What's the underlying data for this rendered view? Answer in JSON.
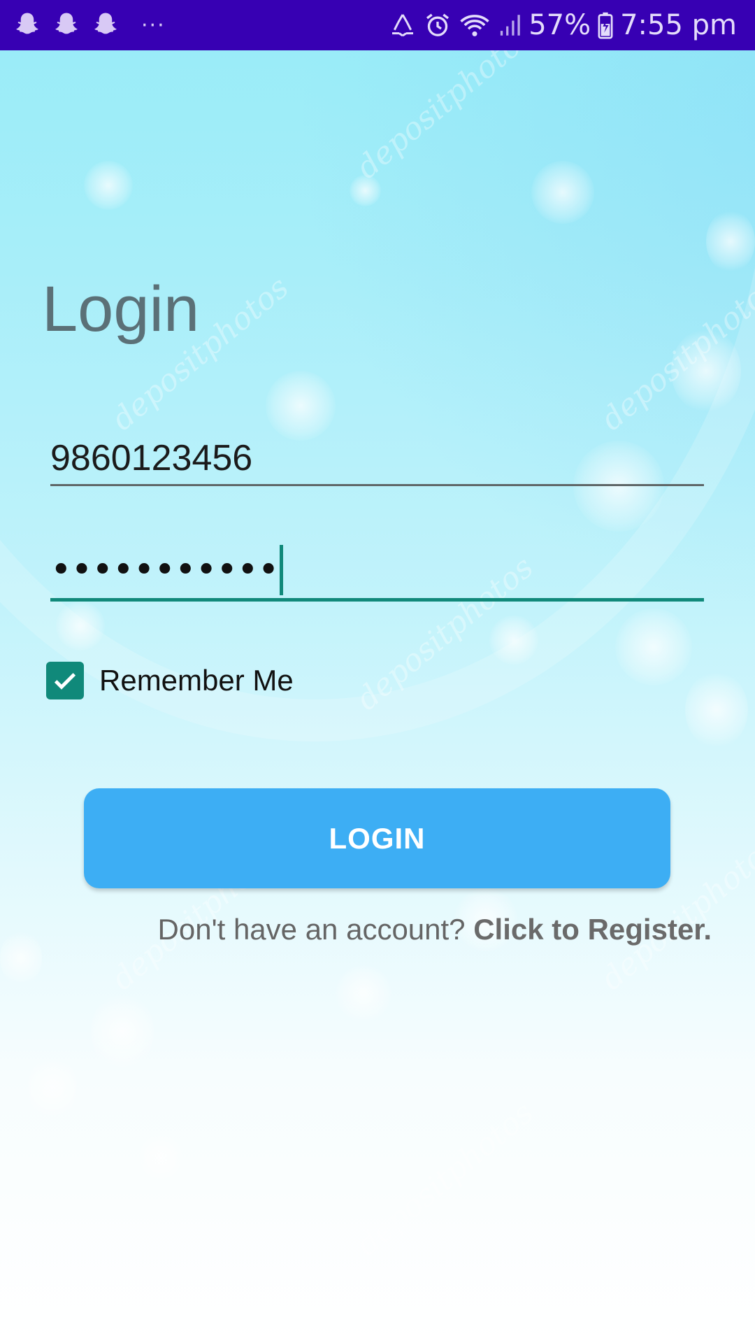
{
  "status_bar": {
    "notification_icons": [
      "snapchat-icon",
      "snapchat-icon",
      "snapchat-icon"
    ],
    "overflow": "···",
    "battery": "57%",
    "time": "7:55 pm"
  },
  "login": {
    "title": "Login",
    "phone_value": "9860123456",
    "password_mask": "•••••••••••",
    "remember_label": "Remember Me",
    "remember_checked": true,
    "login_button": "LOGIN",
    "register_prompt": "Don't have an account?",
    "register_link": "Click to Register."
  },
  "background": {
    "watermark_text": "depositphotos"
  },
  "colors": {
    "status_bar": "#3700b3",
    "accent": "#10897a",
    "button": "#3daef4",
    "title": "#5b7077"
  }
}
